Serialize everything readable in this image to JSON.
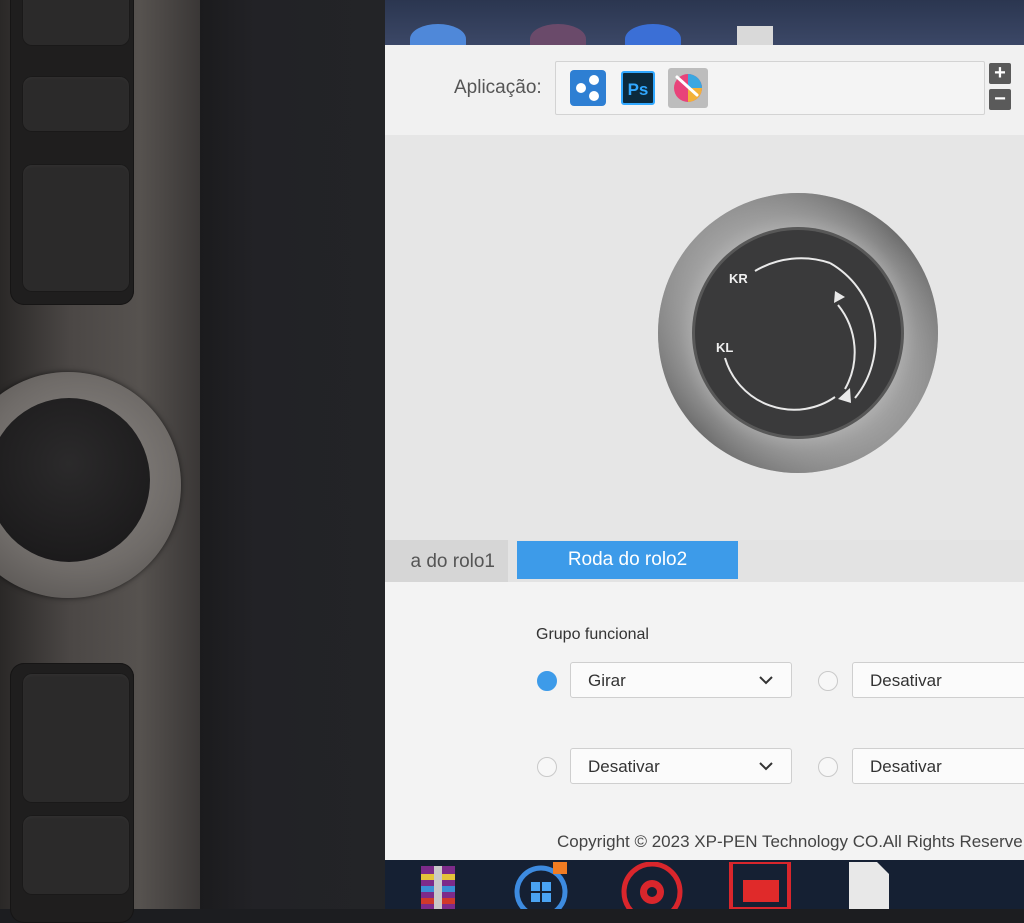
{
  "app_selector": {
    "label": "Aplicação:",
    "apps": [
      {
        "name": "default-app-icon",
        "selected": false
      },
      {
        "name": "photoshop-icon",
        "text": "Ps",
        "selected": false
      },
      {
        "name": "krita-icon",
        "selected": true
      }
    ],
    "add_label": "+",
    "remove_label": "−"
  },
  "dial": {
    "top_label": "KR",
    "bottom_label": "KL"
  },
  "tabs": [
    {
      "label": "a do rolo1",
      "active": false
    },
    {
      "label": "Roda do rolo2",
      "active": true
    }
  ],
  "functional_group": {
    "title": "Grupo funcional",
    "options": [
      {
        "value": "Girar",
        "selected": true
      },
      {
        "value": "Desativar",
        "selected": false
      },
      {
        "value": "Desativar",
        "selected": false
      },
      {
        "value": "Desativar",
        "selected": false
      }
    ]
  },
  "footer": {
    "copyright": "Copyright © 2023  XP-PEN Technology CO.All Rights Reserve"
  },
  "colors": {
    "accent": "#3d9be9",
    "window_bg": "#ececec",
    "taskbar": "#152033"
  }
}
